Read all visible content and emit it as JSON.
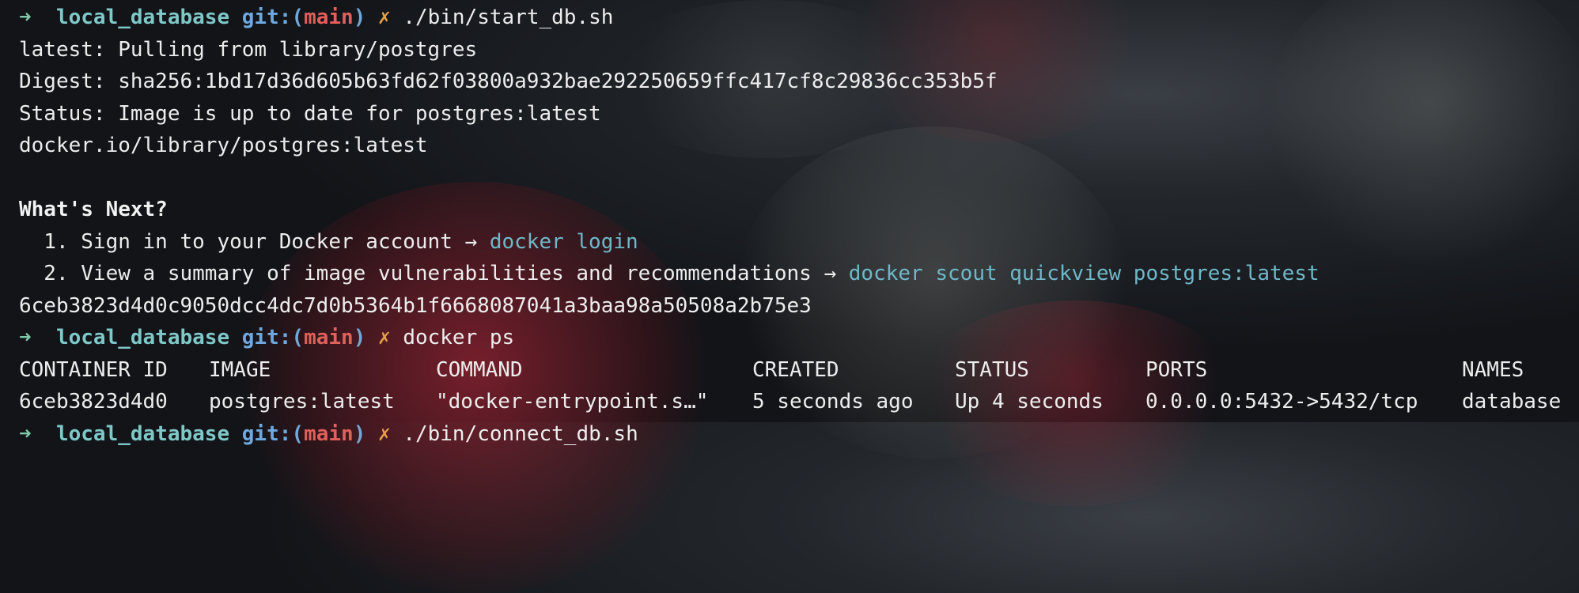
{
  "prompt": {
    "arrow": "➜",
    "directory": "local_database",
    "git_prefix": "git:(",
    "branch": "main",
    "git_suffix": ")",
    "dirty_mark": "✗"
  },
  "commands": {
    "first": "./bin/start_db.sh",
    "second": "docker ps",
    "third_partial": "./bin/connect_db.sh"
  },
  "output": {
    "pull": "latest: Pulling from library/postgres",
    "digest": "Digest: sha256:1bd17d36d605b63fd62f03800a932bae292250659ffc417cf8c29836cc353b5f",
    "status": "Status: Image is up to date for postgres:latest",
    "image_ref": "docker.io/library/postgres:latest",
    "whats_next_title": "What's Next?",
    "next_items": [
      {
        "text": "  1. Sign in to your Docker account → ",
        "cmd": "docker login"
      },
      {
        "text": "  2. View a summary of image vulnerabilities and recommendations → ",
        "cmd": "docker scout quickview postgres:latest"
      }
    ],
    "container_hash": "6ceb3823d4d0c9050dcc4dc7d0b5364b1f6668087041a3baa98a50508a2b75e3"
  },
  "table": {
    "headers": [
      "CONTAINER ID",
      "IMAGE",
      "COMMAND",
      "CREATED",
      "STATUS",
      "PORTS",
      "NAMES"
    ],
    "rows": [
      [
        "6ceb3823d4d0",
        "postgres:latest",
        "\"docker-entrypoint.s…\"",
        "5 seconds ago",
        "Up 4 seconds",
        "0.0.0.0:5432->5432/tcp",
        "database"
      ]
    ]
  },
  "colors": {
    "background": "#121418",
    "arrow": "#7fc8a9",
    "directory": "#7fc8c8",
    "git": "#6fa8dc",
    "branch": "#e0605a",
    "dirty": "#e6a04a",
    "link_cmd": "#6fb8c9"
  }
}
